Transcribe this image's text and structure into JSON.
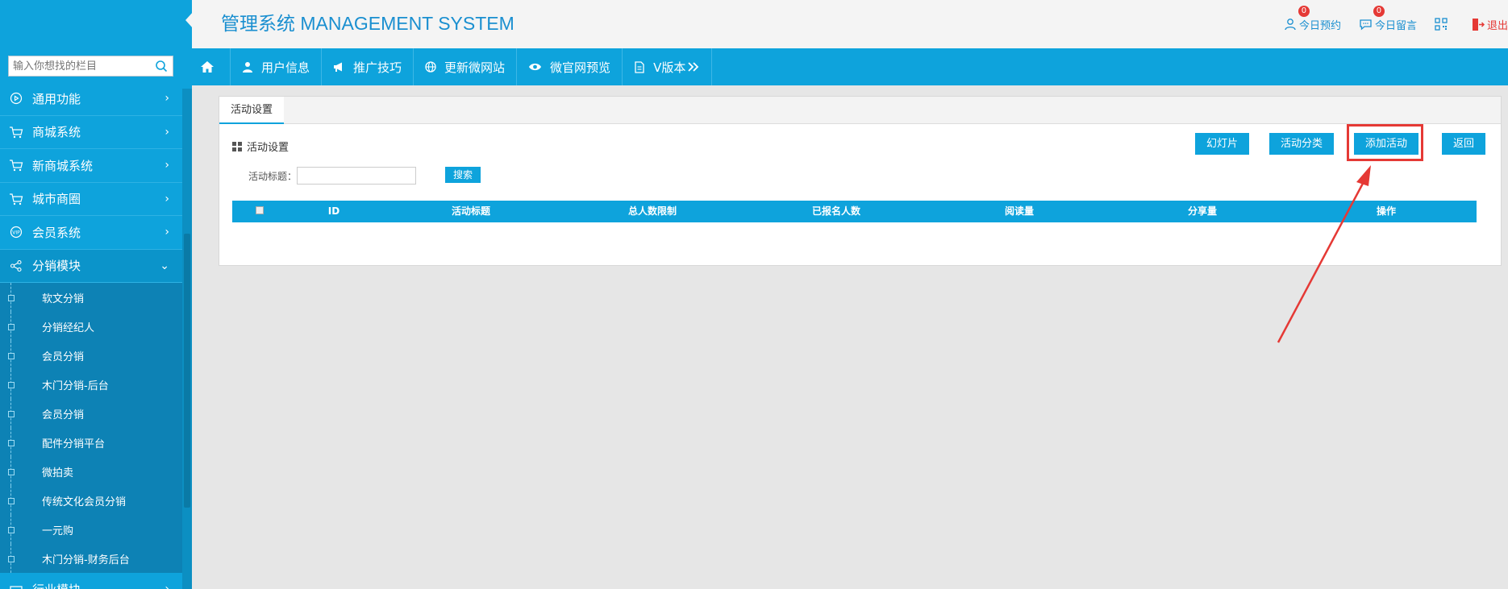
{
  "sidebar": {
    "search_placeholder": "输入你想找的栏目",
    "items": [
      {
        "label": "通用功能",
        "icon": "play-circle-icon"
      },
      {
        "label": "商城系统",
        "icon": "cart-icon"
      },
      {
        "label": "新商城系统",
        "icon": "cart-icon"
      },
      {
        "label": "城市商圈",
        "icon": "cart-icon"
      },
      {
        "label": "会员系统",
        "icon": "vip-icon"
      },
      {
        "label": "分销模块",
        "icon": "share-icon",
        "open": true
      },
      {
        "label": "行业模块",
        "icon": "industry-icon"
      }
    ],
    "sub_items": [
      "软文分销",
      "分销经纪人",
      "会员分销",
      "木门分销-后台",
      "会员分销",
      "配件分销平台",
      "微拍卖",
      "传统文化会员分销",
      "一元购",
      "木门分销-财务后台"
    ]
  },
  "header": {
    "title": "管理系统 MANAGEMENT SYSTEM",
    "actions": {
      "appointments": {
        "label": "今日预约",
        "badge": "0"
      },
      "messages": {
        "label": "今日留言",
        "badge": "0"
      },
      "logout": {
        "label": "退出"
      }
    }
  },
  "nav": {
    "items": [
      {
        "label": "用户信息",
        "icon": "user-icon"
      },
      {
        "label": "推广技巧",
        "icon": "megaphone-icon"
      },
      {
        "label": "更新微网站",
        "icon": "globe-icon"
      },
      {
        "label": "微官网预览",
        "icon": "eye-icon"
      },
      {
        "label": "V版本",
        "icon": "document-icon"
      }
    ]
  },
  "panel": {
    "tab_label": "活动设置",
    "section_title": "活动设置",
    "buttons": {
      "slideshow": "幻灯片",
      "category": "活动分类",
      "add": "添加活动",
      "back": "返回"
    },
    "filter": {
      "label": "活动标题：",
      "value": "",
      "search_button": "搜索"
    },
    "table": {
      "columns": [
        "ID",
        "活动标题",
        "总人数限制",
        "已报名人数",
        "阅读量",
        "分享量",
        "操作"
      ],
      "rows": []
    }
  },
  "colors": {
    "primary": "#0ea3dc",
    "title": "#1a8fd0",
    "annotation": "#e53935"
  }
}
